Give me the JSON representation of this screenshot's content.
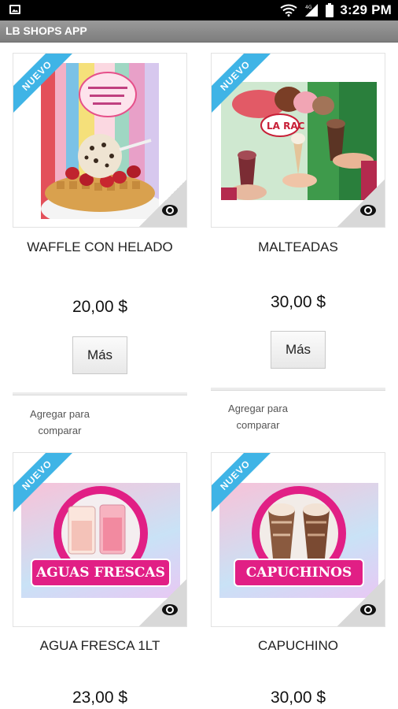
{
  "status_bar": {
    "time": "3:29 PM"
  },
  "app_bar": {
    "title": "LB SHOPS APP"
  },
  "products": [
    {
      "badge": "NUEVO",
      "title": "WAFFLE CON HELADO",
      "price": "20,00 $",
      "more_label": "Más",
      "compare_label": "Agregar para comparar"
    },
    {
      "badge": "NUEVO",
      "title": "MALTEADAS",
      "price": "30,00 $",
      "more_label": "Más",
      "compare_label": "Agregar para comparar"
    },
    {
      "badge": "NUEVO",
      "title": "AGUA FRESCA 1LT",
      "price": "23,00 $",
      "image_text": "AGUAS FRESCAS"
    },
    {
      "badge": "NUEVO",
      "title": "CAPUCHINO",
      "price": "30,00 $",
      "image_text": "CAPUCHINOS"
    }
  ]
}
